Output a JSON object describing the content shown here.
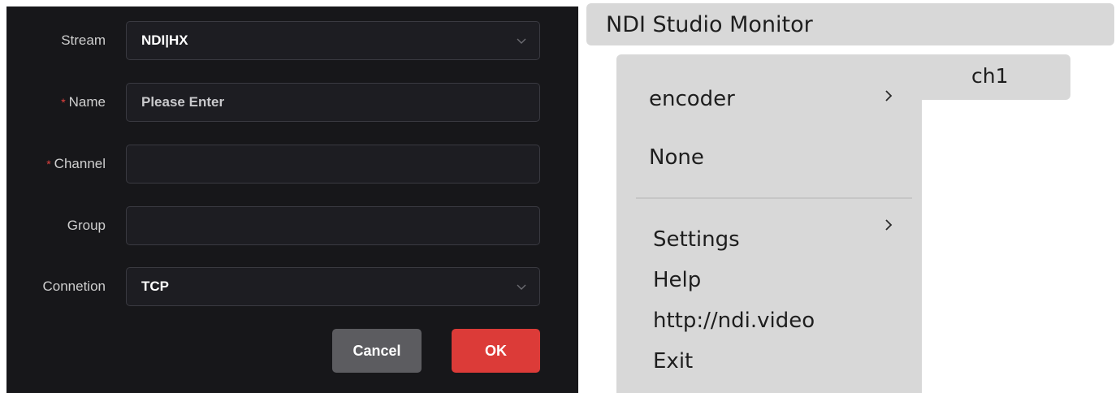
{
  "dialog": {
    "stream_label": "Stream",
    "stream_value": "NDI|HX",
    "name_label": "Name",
    "name_placeholder": "Please Enter",
    "channel_label": "Channel",
    "channel_value": "",
    "group_label": "Group",
    "group_value": "",
    "connection_label": "Connetion",
    "connection_value": "TCP",
    "required_mark": "*",
    "cancel_label": "Cancel",
    "ok_label": "OK"
  },
  "context_menu": {
    "app_title": "NDI Studio Monitor",
    "submenu_item": "ch1",
    "items": [
      {
        "label": "encoder",
        "has_submenu": true
      },
      {
        "label": "None",
        "has_submenu": false
      },
      {
        "label": "Settings",
        "has_submenu": true
      },
      {
        "label": "Help",
        "has_submenu": false
      },
      {
        "label": "http://ndi.video",
        "has_submenu": false
      },
      {
        "label": "Exit",
        "has_submenu": false
      }
    ]
  },
  "colors": {
    "dialog_bg": "#17171a",
    "field_bg": "#1d1d22",
    "ok_button": "#dc3b38",
    "cancel_button": "#5c5c60",
    "required_mark": "#e0403e",
    "menu_bg": "#d8d8d8"
  }
}
